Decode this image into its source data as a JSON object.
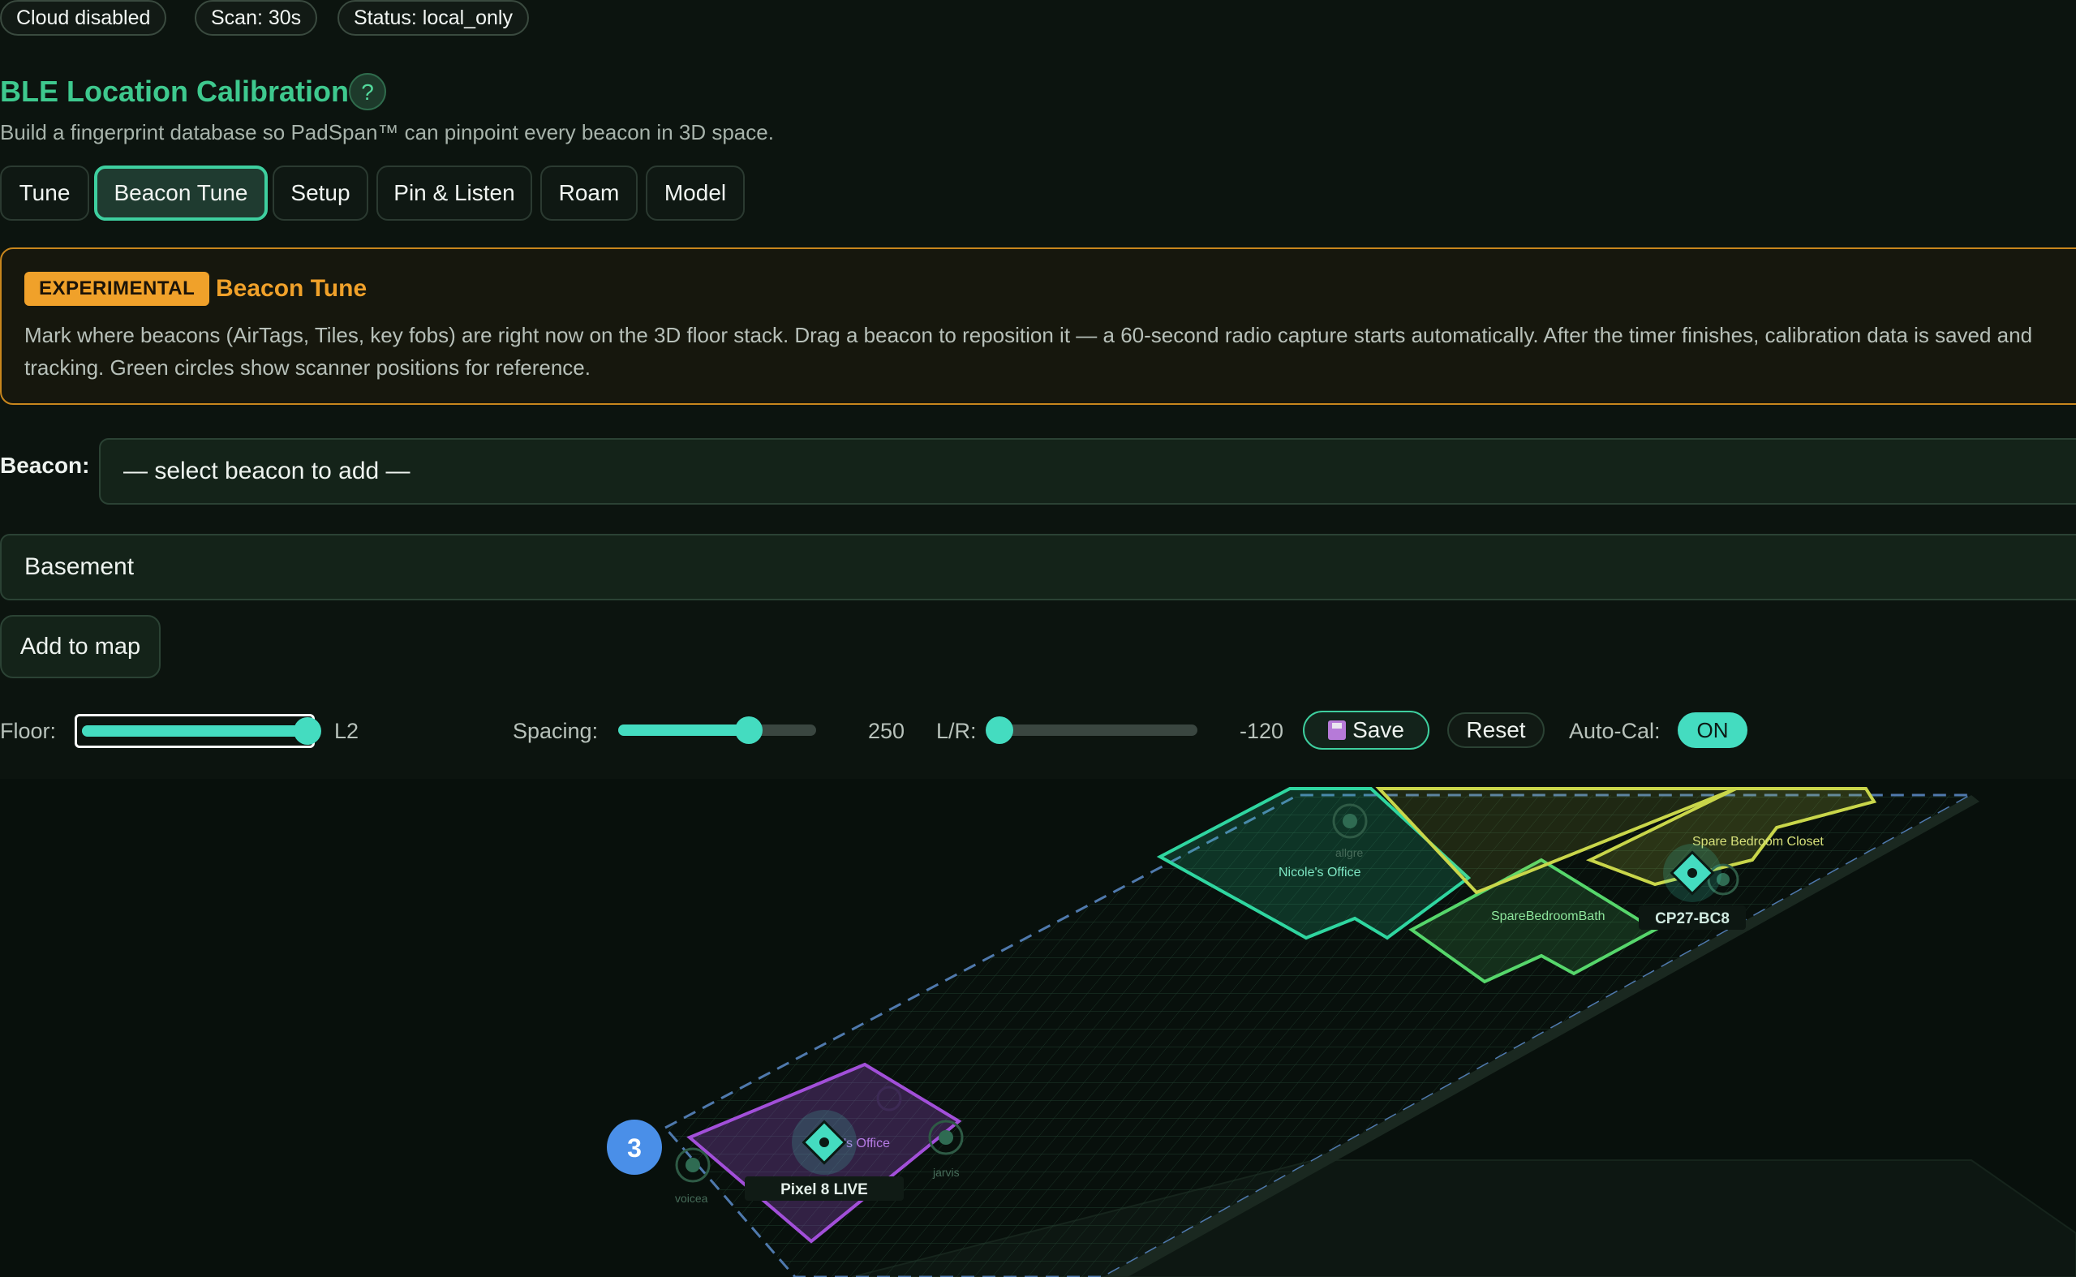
{
  "status_bar": {
    "cloud": "Cloud disabled",
    "scan": "Scan: 30s",
    "status": "Status: local_only"
  },
  "header": {
    "title": "BLE Location Calibration",
    "help": "?",
    "subtitle": "Build a fingerprint database so PadSpan™ can pinpoint every beacon in 3D space."
  },
  "tabs": [
    {
      "label": "Tune"
    },
    {
      "label": "Beacon Tune"
    },
    {
      "label": "Setup"
    },
    {
      "label": "Pin & Listen"
    },
    {
      "label": "Roam"
    },
    {
      "label": "Model"
    }
  ],
  "active_tab": "Beacon Tune",
  "info": {
    "badge": "EXPERIMENTAL",
    "title": "Beacon Tune",
    "text": "Mark where beacons (AirTags, Tiles, key fobs) are right now on the 3D floor stack. Drag a beacon to reposition it — a 60-second radio capture starts automatically. After the timer finishes, calibration data is saved and tracking. Green circles show scanner positions for reference."
  },
  "beacon_form": {
    "label": "Beacon:",
    "select_value": "— select beacon to add —",
    "floor_select_value": "Basement",
    "add_button": "Add to map"
  },
  "controls": {
    "floor_label": "Floor:",
    "floor_value": "L2",
    "floor_level": 1.0,
    "spacing_label": "Spacing:",
    "spacing_value": "250",
    "spacing_level": 0.66,
    "lr_label": "L/R:",
    "lr_value": "-120",
    "lr_level": 0.0,
    "save_label": "Save",
    "save_icon": "floppy-disk-icon",
    "reset_label": "Reset",
    "autocal_label": "Auto-Cal:",
    "autocal_value": "ON"
  },
  "map": {
    "floor_badge": "3",
    "rooms": [
      {
        "name": "Nicole's Office",
        "color": "#2fd6a0"
      },
      {
        "name": "SpareBedroomBath",
        "color": "#56d66b"
      },
      {
        "name": "Spare Bedroom Closet",
        "color": "#c9d64a"
      },
      {
        "name": "'s Office",
        "color": "#a24fd9"
      }
    ],
    "scanners": [
      "allgre",
      "voicea",
      "jarvis"
    ],
    "beacons": [
      {
        "label": "CP27-BC8"
      },
      {
        "label": "Pixel 8 LIVE"
      }
    ],
    "colors": {
      "accent": "#44dcc0",
      "brand_green": "#3ec98e",
      "warning": "#f0a12a",
      "floor_badge": "#4a8fe8"
    }
  }
}
